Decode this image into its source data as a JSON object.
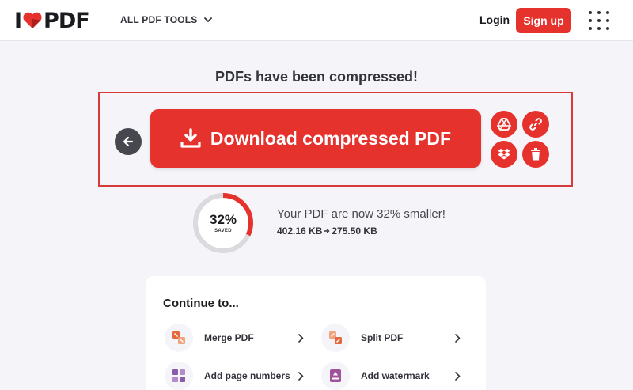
{
  "header": {
    "logo_text_left": "I",
    "logo_text_right": "PDF",
    "tools_menu_label": "ALL PDF TOOLS",
    "login_label": "Login",
    "signup_label": "Sign up"
  },
  "main": {
    "headline": "PDFs have been compressed!",
    "download_label": "Download compressed PDF",
    "actions": [
      "save-to-google-drive",
      "share-link",
      "save-to-dropbox",
      "delete"
    ]
  },
  "result": {
    "percent_saved": 32,
    "percent_label": "32%",
    "saved_label": "SAVED",
    "message": "Your PDF are now 32% smaller!",
    "original_size": "402.16 KB",
    "compressed_size": "275.50 KB"
  },
  "continue": {
    "title": "Continue to...",
    "tools": [
      {
        "label": "Merge PDF",
        "icon": "merge-pdf-icon"
      },
      {
        "label": "Split PDF",
        "icon": "split-pdf-icon"
      },
      {
        "label": "Add page numbers",
        "icon": "page-numbers-icon"
      },
      {
        "label": "Add watermark",
        "icon": "watermark-icon"
      }
    ]
  },
  "colors": {
    "brand_red": "#e5322d",
    "dark": "#33333b",
    "background": "#f4f4f9",
    "gauge_track": "#dadadf",
    "merge_orange": "#e5683d",
    "numbers_purple": "#8c5aa8",
    "watermark_purple": "#a0539b"
  }
}
